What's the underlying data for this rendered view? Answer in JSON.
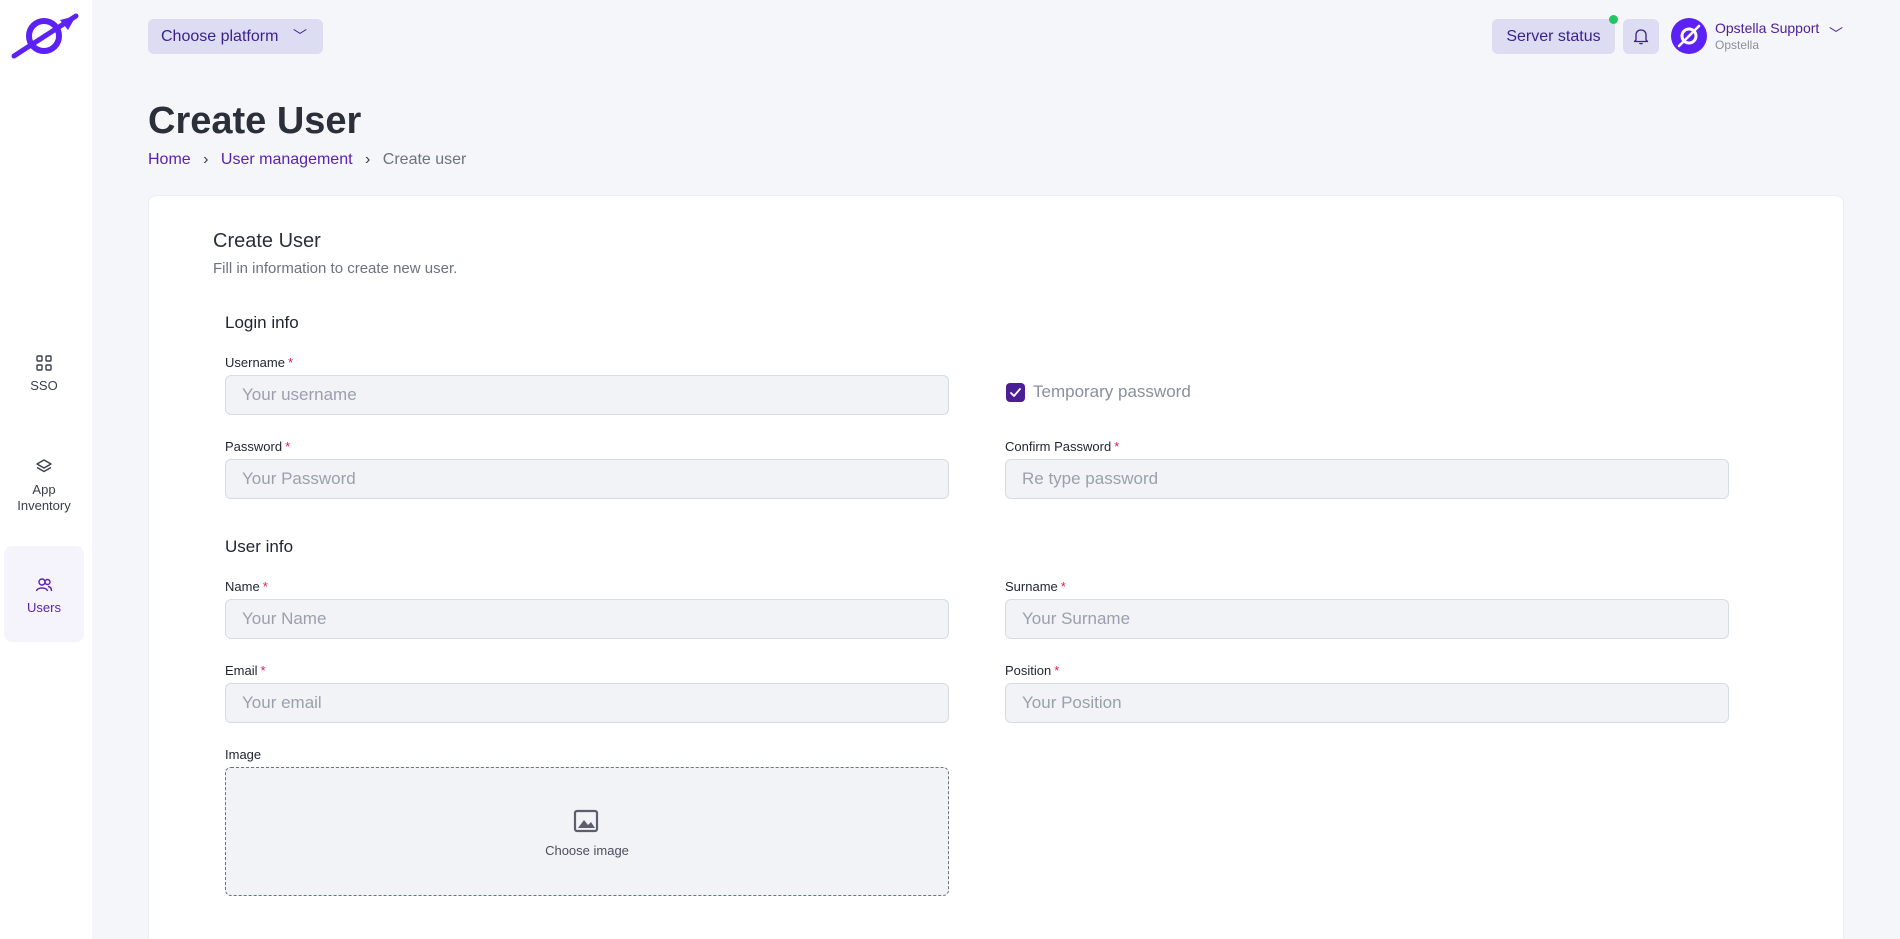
{
  "sidebar": {
    "items": [
      {
        "label": "SSO",
        "icon": "grid-icon"
      },
      {
        "label_line1": "App",
        "label_line2": "Inventory",
        "icon": "layers-icon"
      },
      {
        "label": "Users",
        "icon": "users-icon",
        "active": true
      }
    ]
  },
  "topbar": {
    "platform_label": "Choose platform",
    "server_status_label": "Server status",
    "user_name": "Opstella Support",
    "user_org": "Opstella"
  },
  "header": {
    "title": "Create User",
    "breadcrumb": [
      "Home",
      "User management",
      "Create user"
    ]
  },
  "card": {
    "title": "Create User",
    "subtitle": "Fill in information to create new user.",
    "login_section": "Login info",
    "user_section": "User info",
    "fields": {
      "username": {
        "label": "Username",
        "placeholder": "Your username"
      },
      "password": {
        "label": "Password",
        "placeholder": "Your Password"
      },
      "confirm_password": {
        "label": "Confirm Password",
        "placeholder": "Re type password"
      },
      "name": {
        "label": "Name",
        "placeholder": "Your Name"
      },
      "surname": {
        "label": "Surname",
        "placeholder": "Your Surname"
      },
      "email": {
        "label": "Email",
        "placeholder": "Your email"
      },
      "position": {
        "label": "Position",
        "placeholder": "Your Position"
      },
      "image": {
        "label": "Image",
        "button": "Choose image"
      }
    },
    "temporary_password": {
      "label": "Temporary password",
      "checked": true
    }
  },
  "colors": {
    "accent": "#4c1d95",
    "brand": "#5b21f5",
    "status_online": "#22c55e",
    "button_bg": "#dcdcf3"
  }
}
